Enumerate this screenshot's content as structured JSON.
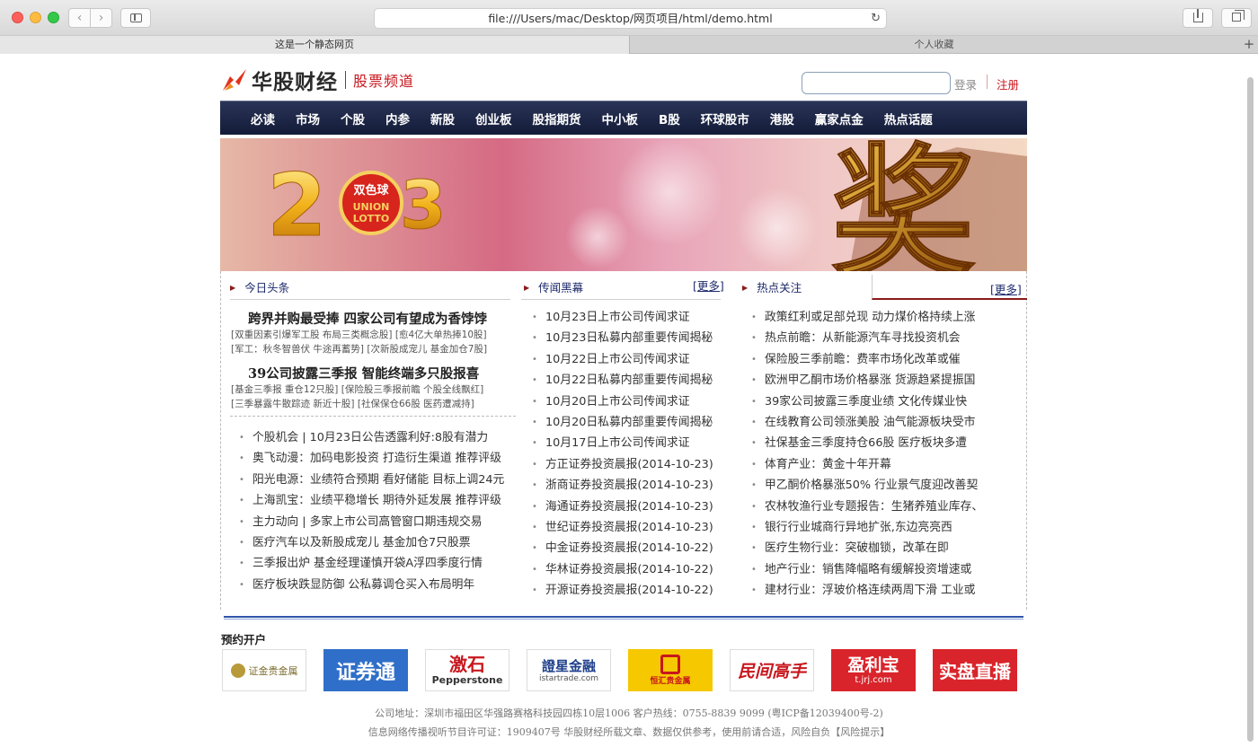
{
  "browser": {
    "url": "file:///Users/mac/Desktop/网页项目/html/demo.html",
    "tabs": [
      {
        "label": "这是一个静态网页"
      },
      {
        "label": "个人收藏"
      }
    ],
    "new_tab_label": "+",
    "back_label": "‹",
    "forward_label": "›",
    "reload_label": "↻"
  },
  "header": {
    "logo_text": "华股财经",
    "channel": "股票频道",
    "login": "登录",
    "register": "注册",
    "search_placeholder": ""
  },
  "nav": [
    "必读",
    "市场",
    "个股",
    "内参",
    "新股",
    "创业板",
    "股指期货",
    "中小板",
    "B股",
    "环球股市",
    "港股",
    "赢家点金",
    "热点话题"
  ],
  "banner": {
    "digits_left": "2",
    "digits_right": "3",
    "logo_cn": "双色球",
    "logo_en1": "UNION",
    "logo_en2": "LOTTO",
    "big_char": "奖"
  },
  "today": {
    "title": "今日头条",
    "headlines": [
      {
        "title": "跨界并购最受捧 四家公司有望成为香饽饽",
        "sub1": "[双重因素引爆军工股 布局三类概念股] [愈4亿大单热捧10股]",
        "sub2": "[军工：秋冬智兽伏 牛途再蓄势] [次新股成宠儿 基金加仓7股]"
      },
      {
        "title": "39公司披露三季报 智能终端多只股报喜",
        "sub1": "[基金三季报 重仓12只股] [保险股三季报前瞻 个股全线飘红]",
        "sub2": "[三季暴露牛散踪迹 新近十股] [社保保仓66股 医药遭减持]"
      }
    ],
    "list": [
      "个股机会 | 10月23日公告透露利好:8股有潜力",
      "奥飞动漫：加码电影投资 打造衍生渠道 推荐评级",
      "阳光电源：业绩符合预期 看好储能 目标上调24元",
      "上海凯宝：业绩平稳增长 期待外延发展 推荐评级",
      "主力动向 | 多家上市公司高管窗口期违规交易",
      "医疗汽车以及新股成宠儿 基金加仓7只股票",
      "三季报出炉 基金经理谨慎开袋A浮四季度行情",
      "医疗板块跌显防御 公私募调仓买入布局明年"
    ]
  },
  "rumor": {
    "title": "传闻黑幕",
    "more": "[更多]",
    "list": [
      "10月23日上市公司传闻求证",
      "10月23日私募内部重要传闻揭秘",
      "10月22日上市公司传闻求证",
      "10月22日私募内部重要传闻揭秘",
      "10月20日上市公司传闻求证",
      "10月20日私募内部重要传闻揭秘",
      "10月17日上市公司传闻求证",
      "方正证券投资晨报(2014-10-23)",
      "浙商证券投资晨报(2014-10-23)",
      "海通证券投资晨报(2014-10-23)",
      "世纪证券投资晨报(2014-10-23)",
      "中金证券投资晨报(2014-10-22)",
      "华林证券投资晨报(2014-10-22)",
      "开源证券投资晨报(2014-10-22)"
    ]
  },
  "hot": {
    "title": "热点关注",
    "more": "[更多]",
    "list": [
      "政策红利或足部兑现 动力煤价格持续上涨",
      "热点前瞻：从新能源汽车寻找投资机会",
      "保险股三季前瞻：费率市场化改革或催",
      "欧洲甲乙酮市场价格暴涨 货源趋紧提振国",
      "39家公司披露三季度业绩 文化传媒业快",
      "在线教育公司领涨美股 油气能源板块受市",
      "社保基金三季度持仓66股 医疗板块多遭",
      "体育产业：黄金十年开幕",
      "甲乙酮价格暴涨50% 行业景气度迎改善契",
      "农林牧渔行业专题报告：生猪养殖业库存、",
      "银行行业城商行异地扩张,东边亮亮西",
      "医疗生物行业：突破枷锁，改革在即",
      "地产行业：销售降幅略有缓解投资增速或",
      "建材行业：浮玻价格连续两周下滑 工业或"
    ]
  },
  "partners_title": "预约开户",
  "partners": [
    {
      "name": "证金贵金属",
      "bg": "#ffffff",
      "fg": "#7a6a2a"
    },
    {
      "name": "证券通",
      "bg": "#2f6fc9",
      "fg": "#ffffff"
    },
    {
      "name": "激石",
      "sub": "Pepperstone",
      "bg": "#ffffff",
      "fg": "#c8161d"
    },
    {
      "name": "證星金融",
      "sub": "istartrade.com",
      "bg": "#ffffff",
      "fg": "#1d3f8a"
    },
    {
      "name": "恒汇贵金属",
      "bg": "#f5c800",
      "fg": "#c8161d"
    },
    {
      "name": "民间高手",
      "bg": "#ffffff",
      "fg": "#c8161d"
    },
    {
      "name": "盈利宝",
      "sub": "t.jrj.com",
      "bg": "#d9242b",
      "fg": "#ffffff"
    },
    {
      "name": "实盘直播",
      "bg": "#d9242b",
      "fg": "#ffffff"
    }
  ],
  "footer": {
    "line1": "公司地址：深圳市福田区华强路赛格科技园四栋10层1006 客户热线：0755-8839 9099 (粤ICP备12039400号-2)",
    "line2": "信息网络传播视听节目许可证：1909407号 华股财经所载文章、数据仅供参考，使用前请合适，风险自负【风险提示】"
  },
  "colors": {
    "nav_bg": "#1b2446",
    "accent_red": "#c9161d",
    "link_blue": "#1d2a6b"
  }
}
